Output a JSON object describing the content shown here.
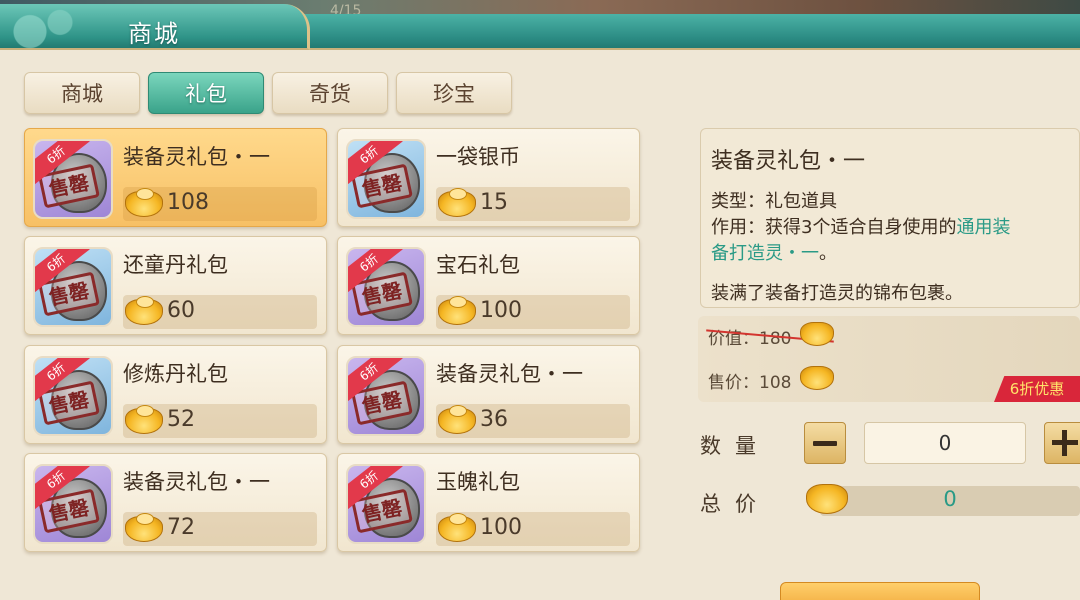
{
  "window": {
    "counter": "4/15",
    "title": "商城"
  },
  "tabs": [
    {
      "label": "商城",
      "active": false
    },
    {
      "label": "礼包",
      "active": true
    },
    {
      "label": "奇货",
      "active": false
    },
    {
      "label": "珍宝",
      "active": false
    }
  ],
  "items": [
    {
      "name": "装备灵礼包・一",
      "price": "108",
      "badge": "6折",
      "stamp": "售罄",
      "bg": "purple",
      "selected": true
    },
    {
      "name": "一袋银币",
      "price": "15",
      "badge": "6折",
      "stamp": "售罄",
      "bg": "blue",
      "selected": false
    },
    {
      "name": "还童丹礼包",
      "price": "60",
      "badge": "6折",
      "stamp": "售罄",
      "bg": "blue",
      "selected": false
    },
    {
      "name": "宝石礼包",
      "price": "100",
      "badge": "6折",
      "stamp": "售罄",
      "bg": "purple",
      "selected": false
    },
    {
      "name": "修炼丹礼包",
      "price": "52",
      "badge": "6折",
      "stamp": "售罄",
      "bg": "blue",
      "selected": false
    },
    {
      "name": "装备灵礼包・一",
      "price": "36",
      "badge": "6折",
      "stamp": "售罄",
      "bg": "purple",
      "selected": false
    },
    {
      "name": "装备灵礼包・一",
      "price": "72",
      "badge": "6折",
      "stamp": "售罄",
      "bg": "purple",
      "selected": false
    },
    {
      "name": "玉魄礼包",
      "price": "100",
      "badge": "6折",
      "stamp": "售罄",
      "bg": "purple",
      "selected": false
    }
  ],
  "detail": {
    "title": "装备灵礼包・一",
    "type_line": "类型：礼包道具",
    "effect_prefix": "作用：获得3个适合自身使用的",
    "effect_highlight_1": "通用装",
    "effect_highlight_2": "备打造灵・一",
    "effect_suffix": "。",
    "desc": "装满了装备打造灵的锦布包裹。"
  },
  "pricing": {
    "orig_label": "价值：180",
    "sale_label": "售价：108",
    "discount_tag": "6折优惠"
  },
  "purchase": {
    "qty_label": "数量",
    "qty_value": "0",
    "total_label": "总价",
    "total_value": "0"
  },
  "colors": {
    "accent_teal": "#2a9a86",
    "sale_red": "#d9263a",
    "gold": "#f5b623"
  },
  "icons": {
    "currency": "gold-ingot-icon",
    "minus": "minus-icon",
    "plus": "plus-icon"
  }
}
